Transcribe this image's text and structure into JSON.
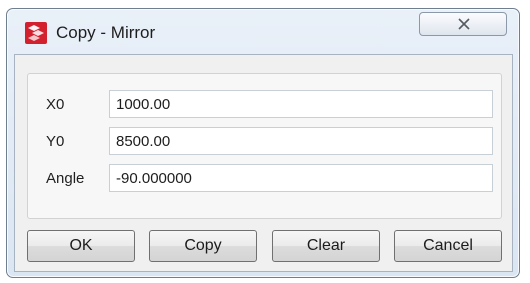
{
  "window": {
    "title": "Copy - Mirror",
    "app_icon": "copy-app-icon",
    "close_icon": "close-x-icon"
  },
  "fields": [
    {
      "label": "X0",
      "value": "1000.00"
    },
    {
      "label": "Y0",
      "value": "8500.00"
    },
    {
      "label": "Angle",
      "value": "-90.000000"
    }
  ],
  "buttons": {
    "ok": "OK",
    "copy": "Copy",
    "clear": "Clear",
    "cancel": "Cancel"
  },
  "colors": {
    "icon_red": "#d3202f",
    "titlebar": "#dfe8f3",
    "client_bg": "#f0f0f0"
  }
}
